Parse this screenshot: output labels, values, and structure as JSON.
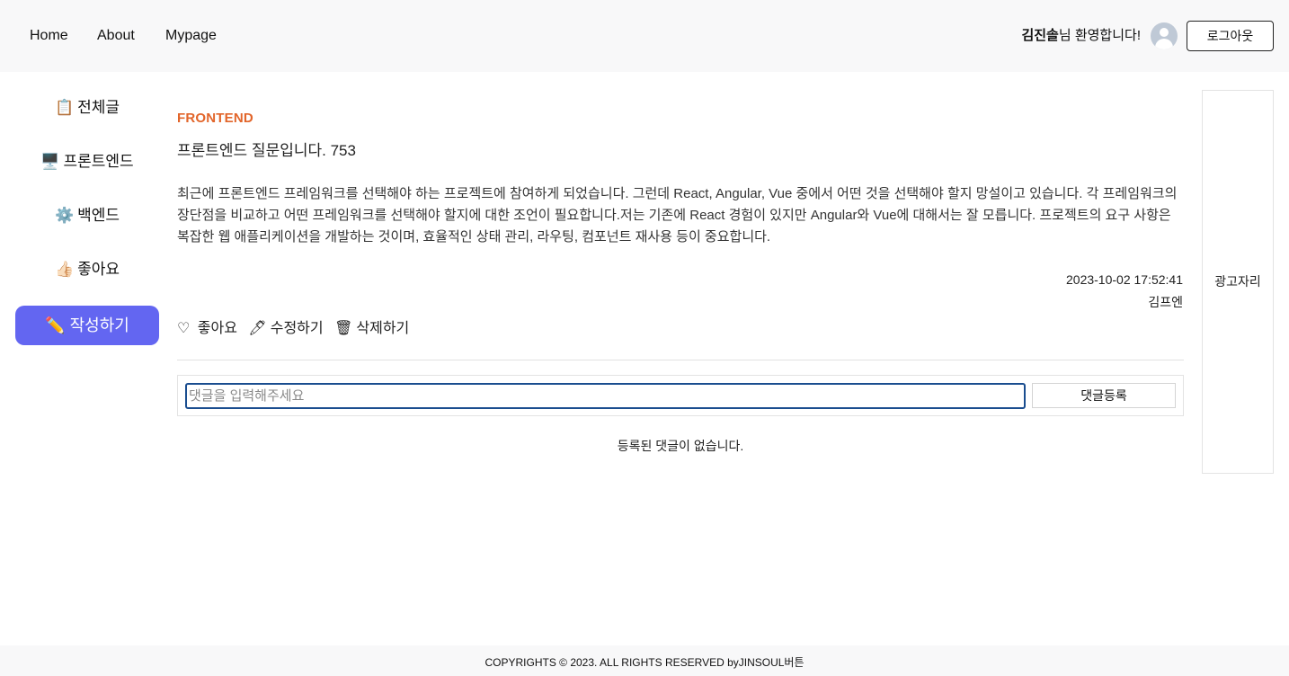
{
  "nav": {
    "home": "Home",
    "about": "About",
    "mypage": "Mypage"
  },
  "user": {
    "name": "김진솔",
    "greeting_suffix": "님 환영합니다!",
    "logout_label": "로그아웃"
  },
  "sidebar": {
    "items": [
      {
        "icon": "📋",
        "label": "전체글"
      },
      {
        "icon": "🖥️",
        "label": "프론트엔드"
      },
      {
        "icon": "⚙️",
        "label": "백엔드"
      },
      {
        "icon": "👍🏻",
        "label": "좋아요"
      }
    ],
    "write_icon": "✏️",
    "write_label": "작성하기"
  },
  "post": {
    "category": "FRONTEND",
    "title": "프론트엔드 질문입니다. 753",
    "body": "최근에 프론트엔드 프레임워크를 선택해야 하는 프로젝트에 참여하게 되었습니다. 그런데 React, Angular, Vue 중에서 어떤 것을 선택해야 할지 망설이고 있습니다. 각 프레임워크의 장단점을 비교하고 어떤 프레임워크를 선택해야 할지에 대한 조언이 필요합니다.저는 기존에 React 경험이 있지만 Angular와 Vue에 대해서는 잘 모릅니다. 프로젝트의 요구 사항은 복잡한 웹 애플리케이션을 개발하는 것이며, 효율적인 상태 관리, 라우팅, 컴포넌트 재사용 등이 중요합니다.",
    "date": "2023-10-02 17:52:41",
    "author": "김프엔"
  },
  "actions": {
    "like_icon": "♡",
    "like_label": "좋아요",
    "edit_icon": "🖊",
    "edit_label": "수정하기",
    "delete_icon": "🗑",
    "delete_label": "삭제하기"
  },
  "comments": {
    "placeholder": "댓글을 입력해주세요",
    "value": "",
    "submit_label": "댓글등록",
    "empty_text": "등록된 댓글이 없습니다."
  },
  "ad": {
    "label": "광고자리"
  },
  "footer": {
    "text": "COPYRIGHTS © 2023. ALL RIGHTS RESERVED byJINSOUL버튼"
  },
  "colors": {
    "accent": "#6366f1",
    "category": "#e2652a",
    "input_focus": "#1a4d8f"
  }
}
